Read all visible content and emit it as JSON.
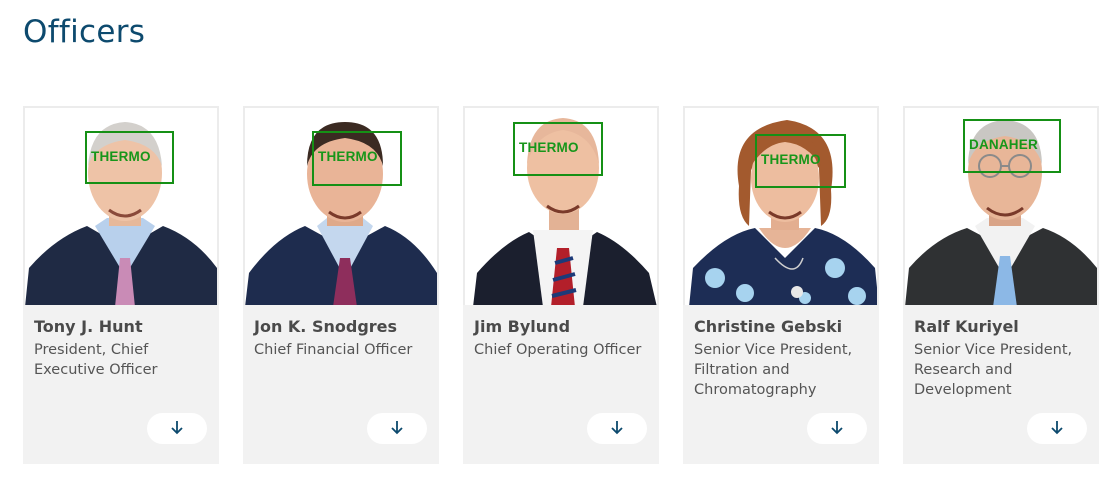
{
  "page": {
    "title": "Officers"
  },
  "officers": [
    {
      "name": "Tony J. Hunt",
      "title": "President, Chief Executive Officer",
      "logo": "THERMO"
    },
    {
      "name": "Jon K. Snodgres",
      "title": "Chief Financial Officer",
      "logo": "THERMO"
    },
    {
      "name": "Jim Bylund",
      "title": "Chief Operating Officer",
      "logo": "THERMO"
    },
    {
      "name": "Christine Gebski",
      "title": "Senior Vice President, Filtration and Chromatography",
      "logo": "THERMO"
    },
    {
      "name": "Ralf Kuriyel",
      "title": "Senior Vice President, Research and Development",
      "logo": "DANAHER"
    }
  ],
  "icons": {
    "expand": "arrow-down-icon"
  },
  "colors": {
    "title": "#0d4a6e",
    "logo_overlay": "#159015",
    "card_bg": "#f2f2f2",
    "arrow": "#0d4a6e"
  }
}
